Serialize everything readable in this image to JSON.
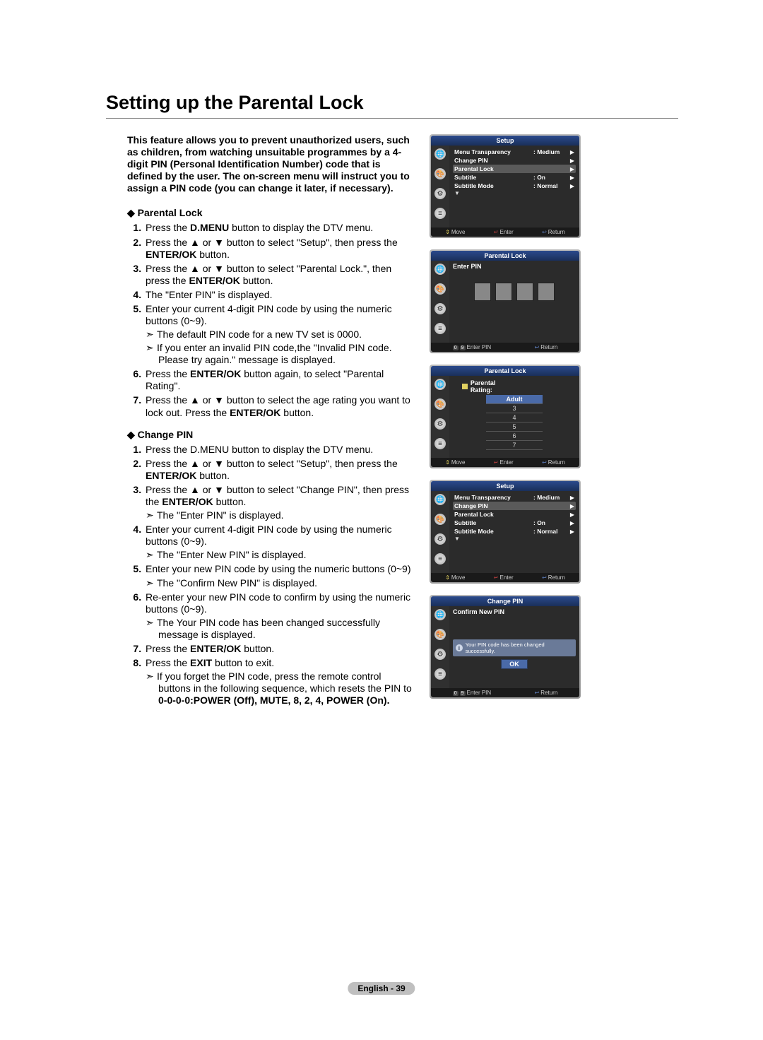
{
  "title": "Setting up the Parental Lock",
  "intro": "This feature allows you to prevent unauthorized users, such as children, from watching unsuitable programmes by a 4-digit PIN (Personal Identification Number) code that is defined by the user.  The on-screen menu will instruct you to assign a PIN code (you can change it later, if necessary).",
  "sectionA": {
    "head": "Parental Lock",
    "s1a": "Press the ",
    "s1b": "D.MENU",
    "s1c": " button to display the DTV menu.",
    "s2a": "Press the ▲ or ▼ button to select \"Setup\", then press the ",
    "s2b": "ENTER/OK",
    "s2c": " button.",
    "s3a": "Press the ▲ or ▼ button to select \"Parental Lock.\", then press the ",
    "s3b": "ENTER/OK",
    "s3c": " button.",
    "s4": "The \"Enter PIN\" is displayed.",
    "s5": "Enter your current 4-digit PIN code by using the numeric buttons (0~9).",
    "s5sub1": "The default PIN code for a new TV set is 0000.",
    "s5sub2": "If you enter an invalid PIN code,the \"Invalid PIN code. Please try again.\" message is displayed.",
    "s6a": "Press the ",
    "s6b": "ENTER/OK",
    "s6c": " button again, to select \"Parental Rating\".",
    "s7a": "Press the ▲ or ▼ button to select the age rating you want to lock out. Press the ",
    "s7b": "ENTER/OK",
    "s7c": " button."
  },
  "sectionB": {
    "head": "Change PIN",
    "s1": "Press the D.MENU button to display the DTV menu.",
    "s2a": "Press the ▲ or ▼ button to select \"Setup\", then press the ",
    "s2b": "ENTER/OK",
    "s2c": " button.",
    "s3a": "Press the ▲ or ▼ button to select \"Change PIN\", then press the ",
    "s3b": "ENTER/OK",
    "s3c": " button.",
    "s3sub": "The \"Enter PIN\" is displayed.",
    "s4": "Enter your current 4-digit PIN code by using the numeric buttons (0~9).",
    "s4sub": "The \"Enter New PIN\" is displayed.",
    "s5": "Enter your new PIN code by using the numeric buttons (0~9)",
    "s5sub": "The \"Confirm New PIN\" is displayed.",
    "s6": "Re-enter your new PIN code to confirm by using the numeric buttons (0~9).",
    "s6sub": "The Your PIN code has been changed successfully message is displayed.",
    "s7a": "Press the ",
    "s7b": "ENTER/OK",
    "s7c": " button.",
    "s8a": "Press the ",
    "s8b": "EXIT",
    "s8c": " button to exit.",
    "s8sub": "If you forget the PIN code, press the remote control buttons in the following sequence, which resets the PIN to ",
    "s8subBold": "0-0-0-0:POWER (Off), MUTE, 8, 2, 4, POWER (On)."
  },
  "osd": {
    "setup": {
      "title": "Setup",
      "rows": [
        {
          "lab": "Menu Transparency",
          "val": ": Medium",
          "tri": "▶"
        },
        {
          "lab": "Change PIN",
          "val": "",
          "tri": "▶"
        },
        {
          "lab": "Parental Lock",
          "val": "",
          "tri": "▶",
          "sel": true
        },
        {
          "lab": "Subtitle",
          "val": ": On",
          "tri": "▶"
        },
        {
          "lab": "Subtitle Mode",
          "val": ": Normal",
          "tri": "▶"
        }
      ],
      "foot": {
        "move": "Move",
        "enter": "Enter",
        "return": "Return"
      }
    },
    "enterpin": {
      "title": "Parental Lock",
      "label": "Enter PIN",
      "foot": {
        "num": "0..9",
        "enterpin": "Enter PIN",
        "return": "Return"
      }
    },
    "rating": {
      "title": "Parental Lock",
      "label": "Parental Rating:",
      "items": [
        "Adult",
        "3",
        "4",
        "5",
        "6",
        "7"
      ],
      "foot": {
        "move": "Move",
        "enter": "Enter",
        "return": "Return"
      }
    },
    "setup2": {
      "title": "Setup",
      "rows": [
        {
          "lab": "Menu Transparency",
          "val": ": Medium",
          "tri": "▶"
        },
        {
          "lab": "Change PIN",
          "val": "",
          "tri": "▶",
          "sel": true
        },
        {
          "lab": "Parental Lock",
          "val": "",
          "tri": "▶"
        },
        {
          "lab": "Subtitle",
          "val": ": On",
          "tri": "▶"
        },
        {
          "lab": "Subtitle Mode",
          "val": ": Normal",
          "tri": "▶"
        }
      ],
      "foot": {
        "move": "Move",
        "enter": "Enter",
        "return": "Return"
      }
    },
    "changepin": {
      "title": "Change PIN",
      "label": "Confirm New PIN",
      "msg": "Your PIN code has been changed successfully.",
      "ok": "OK",
      "foot": {
        "num": "0..9",
        "enterpin": "Enter PIN",
        "return": "Return"
      }
    }
  },
  "pageNum": "English - 39",
  "glyph": {
    "diamond": "◆",
    "succ": "➣",
    "up": "▲",
    "down": "▼",
    "tri": "▶",
    "updown": "⇕",
    "enter": "↵",
    "ret": "↩"
  }
}
